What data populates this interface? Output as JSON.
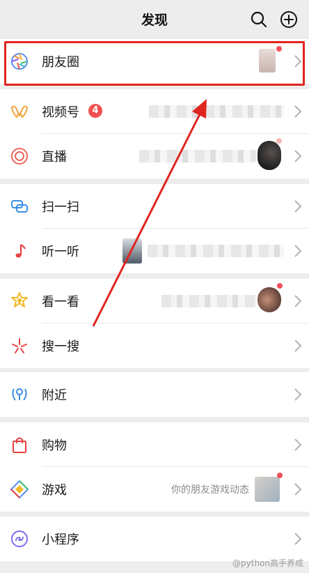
{
  "header": {
    "title": "发现",
    "search_icon": "search-icon",
    "add_icon": "add-circle-icon"
  },
  "items": {
    "moments": {
      "label": "朋友圈",
      "icon": "moments-aperture-icon"
    },
    "channels": {
      "label": "视频号",
      "badge": "4",
      "icon": "channels-icon"
    },
    "live": {
      "label": "直播",
      "icon": "live-icon"
    },
    "scan": {
      "label": "扫一扫",
      "icon": "scan-icon"
    },
    "listen": {
      "label": "听一听",
      "icon": "music-note-icon"
    },
    "top_stories": {
      "label": "看一看",
      "icon": "top-stories-icon"
    },
    "search": {
      "label": "搜一搜",
      "icon": "search-star-icon"
    },
    "nearby": {
      "label": "附近",
      "icon": "nearby-icon"
    },
    "shopping": {
      "label": "购物",
      "icon": "shopping-bag-icon"
    },
    "games": {
      "label": "游戏",
      "hint": "你的朋友游戏动态",
      "icon": "games-icon"
    },
    "mini_programs": {
      "label": "小程序",
      "icon": "mini-programs-icon"
    }
  },
  "watermark": "@python高手养成",
  "colors": {
    "background": "#ededed",
    "highlight": "#e0251f",
    "badge": "#f25050"
  }
}
